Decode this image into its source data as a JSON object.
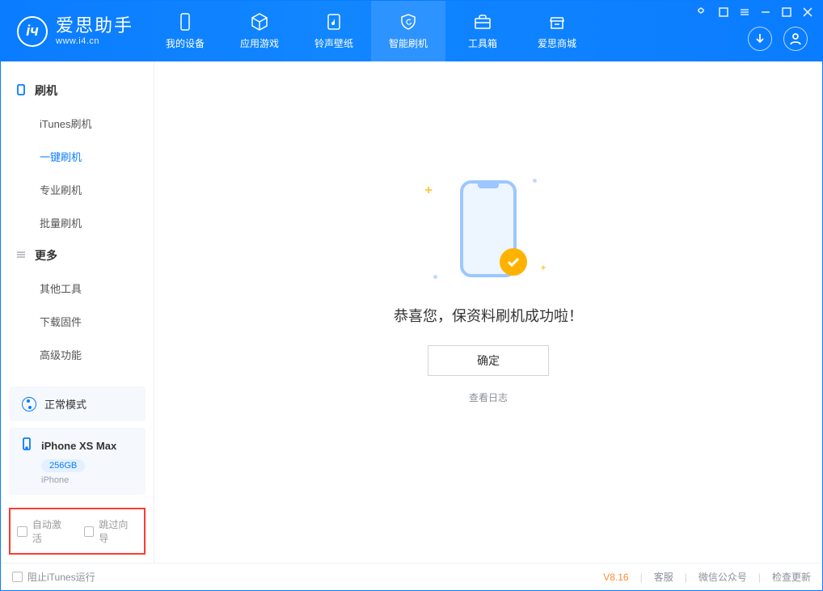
{
  "app": {
    "title": "爱思助手",
    "url": "www.i4.cn"
  },
  "tabs": [
    {
      "label": "我的设备",
      "icon": "device"
    },
    {
      "label": "应用游戏",
      "icon": "cube"
    },
    {
      "label": "铃声壁纸",
      "icon": "music"
    },
    {
      "label": "智能刷机",
      "icon": "refresh",
      "active": true
    },
    {
      "label": "工具箱",
      "icon": "toolbox"
    },
    {
      "label": "爱思商城",
      "icon": "store"
    }
  ],
  "sidebar": {
    "sections": [
      {
        "title": "刷机",
        "icon": "phone",
        "items": [
          {
            "label": "iTunes刷机"
          },
          {
            "label": "一键刷机",
            "active": true
          },
          {
            "label": "专业刷机"
          },
          {
            "label": "批量刷机"
          }
        ]
      },
      {
        "title": "更多",
        "icon": "more",
        "items": [
          {
            "label": "其他工具"
          },
          {
            "label": "下载固件"
          },
          {
            "label": "高级功能"
          }
        ]
      }
    ],
    "mode": {
      "label": "正常模式"
    },
    "device": {
      "name": "iPhone XS Max",
      "storage": "256GB",
      "type": "iPhone"
    },
    "checkboxes": {
      "auto_activate": "自动激活",
      "skip_guide": "跳过向导"
    }
  },
  "main": {
    "success_text": "恭喜您，保资料刷机成功啦！",
    "ok_label": "确定",
    "log_link": "查看日志"
  },
  "statusbar": {
    "block_itunes": "阻止iTunes运行",
    "version": "V8.16",
    "links": {
      "support": "客服",
      "wechat": "微信公众号",
      "update": "检查更新"
    }
  }
}
